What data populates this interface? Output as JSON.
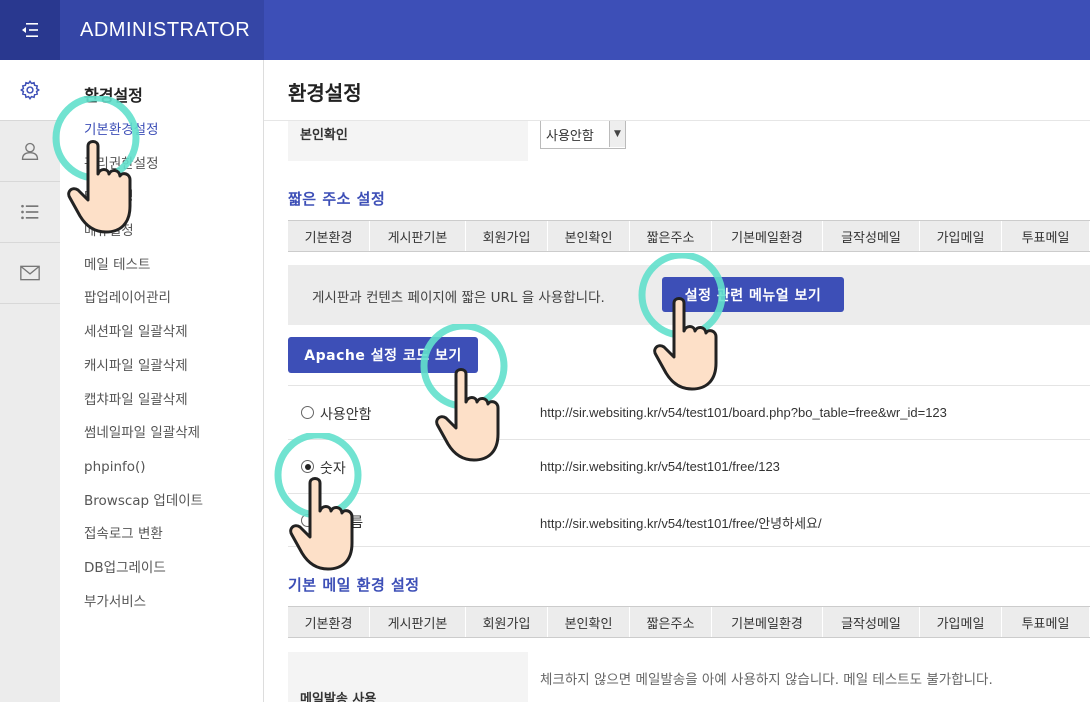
{
  "header": {
    "brand": "ADMINISTRATOR",
    "menu_toggle_icon": "menu-collapse-icon",
    "bar_color": "#3d4fb7"
  },
  "rail": {
    "icons": [
      "gear-icon",
      "user-icon",
      "list-icon",
      "mail-icon"
    ],
    "active_index": 0
  },
  "sidemenu": {
    "title": "환경설정",
    "items": [
      {
        "label": "기본환경설정",
        "active": true
      },
      {
        "label": "관리권한설정"
      },
      {
        "label": "테마설정"
      },
      {
        "label": "메뉴설정"
      },
      {
        "label": "메일 테스트"
      },
      {
        "label": "팝업레이어관리"
      },
      {
        "label": "세션파일 일괄삭제"
      },
      {
        "label": "캐시파일 일괄삭제"
      },
      {
        "label": "캡챠파일 일괄삭제"
      },
      {
        "label": "썸네일파일 일괄삭제"
      },
      {
        "label": "phpinfo()"
      },
      {
        "label": "Browscap 업데이트"
      },
      {
        "label": "접속로그 변환"
      },
      {
        "label": "DB업그레이드"
      },
      {
        "label": "부가서비스"
      }
    ]
  },
  "main": {
    "page_title": "환경설정",
    "cert_row": {
      "label": "본인확인",
      "select_value": "사용안함"
    },
    "short_url": {
      "section_title": "짧은 주소 설정",
      "tabs": [
        "기본환경",
        "게시판기본",
        "회원가입",
        "본인확인",
        "짧은주소",
        "기본메일환경",
        "글작성메일",
        "가입메일",
        "투표메일"
      ],
      "info_text": "게시판과 컨텐츠 페이지에 짧은 URL 을 사용합니다.",
      "manual_button": "설정 관련 메뉴얼 보기",
      "apache_button": "Apache 설정 코드 보기",
      "options": [
        {
          "label": "사용안함",
          "url": "http://sir.websiting.kr/v54/test101/board.php?bo_table=free&wr_id=123",
          "checked": false
        },
        {
          "label": "숫자",
          "url": "http://sir.websiting.kr/v54/test101/free/123",
          "checked": true
        },
        {
          "label": "글 이름",
          "url": "http://sir.websiting.kr/v54/test101/free/안녕하세요/",
          "checked": false
        }
      ]
    },
    "mail": {
      "section_title": "기본 메일 환경 설정",
      "tabs": [
        "기본환경",
        "게시판기본",
        "회원가입",
        "본인확인",
        "짧은주소",
        "기본메일환경",
        "글작성메일",
        "가입메일",
        "투표메일"
      ],
      "row_label": "메일발송 사용",
      "row_desc": "체크하지 않으면 메일발송을 아예 사용하지 않습니다. 메일 테스트도 불가합니다."
    }
  },
  "overlay_icons": [
    "pointer-hand-icon"
  ]
}
